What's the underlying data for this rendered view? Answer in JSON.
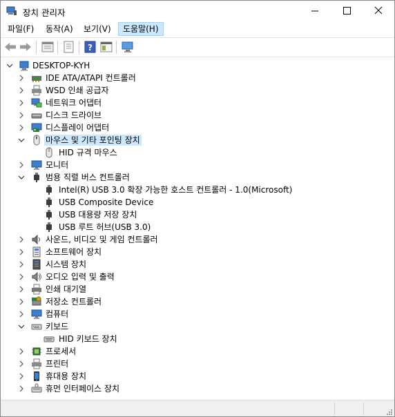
{
  "window": {
    "title": "장치 관리자"
  },
  "menu": [
    "파일(F)",
    "동작(A)",
    "보기(V)",
    "도움말(H)"
  ],
  "tree": {
    "root": "DESKTOP-KYH",
    "categories": [
      {
        "label": "IDE ATA/ATAPI 컨트롤러",
        "icon": "ide-controller-icon",
        "expanded": false
      },
      {
        "label": "WSD 인쇄 공급자",
        "icon": "printer-provider-icon",
        "expanded": false
      },
      {
        "label": "네트워크 어댑터",
        "icon": "network-adapter-icon",
        "expanded": false
      },
      {
        "label": "디스크 드라이브",
        "icon": "disk-drive-icon",
        "expanded": false
      },
      {
        "label": "디스플레이 어댑터",
        "icon": "display-adapter-icon",
        "expanded": false
      },
      {
        "label": "마우스 및 기타 포인팅 장치",
        "icon": "mouse-icon",
        "expanded": true,
        "selected": true,
        "children": [
          "HID 규격 마우스"
        ]
      },
      {
        "label": "모니터",
        "icon": "monitor-icon",
        "expanded": false
      },
      {
        "label": "범용 직렬 버스 컨트롤러",
        "icon": "usb-icon",
        "expanded": true,
        "children": [
          "Intel(R) USB 3.0 확장 가능한 호스트 컨트롤러 - 1.0(Microsoft)",
          "USB Composite Device",
          "USB 대용량 저장 장치",
          "USB 루트 허브(USB 3.0)"
        ]
      },
      {
        "label": "사운드, 비디오 및 게임 컨트롤러",
        "icon": "speaker-icon",
        "expanded": false
      },
      {
        "label": "소프트웨어 장치",
        "icon": "software-device-icon",
        "expanded": false
      },
      {
        "label": "시스템 장치",
        "icon": "system-device-icon",
        "expanded": false
      },
      {
        "label": "오디오 입력 및 출력",
        "icon": "audio-icon",
        "expanded": false
      },
      {
        "label": "인쇄 대기열",
        "icon": "print-queue-icon",
        "expanded": false
      },
      {
        "label": "저장소 컨트롤러",
        "icon": "storage-controller-icon",
        "expanded": false
      },
      {
        "label": "컴퓨터",
        "icon": "computer-icon",
        "expanded": false
      },
      {
        "label": "키보드",
        "icon": "keyboard-icon",
        "expanded": true,
        "children": [
          "HID 키보드 장치"
        ]
      },
      {
        "label": "프로세서",
        "icon": "processor-icon",
        "expanded": false
      },
      {
        "label": "프린터",
        "icon": "printer-icon",
        "expanded": false
      },
      {
        "label": "휴대용 장치",
        "icon": "portable-device-icon",
        "expanded": false
      },
      {
        "label": "휴먼 인터페이스 장치",
        "icon": "hid-icon",
        "expanded": false
      }
    ]
  },
  "colors": {
    "selection": "#cce8ff",
    "selection_border": "#99d1ff",
    "statusbar": "#f0f0f0"
  }
}
